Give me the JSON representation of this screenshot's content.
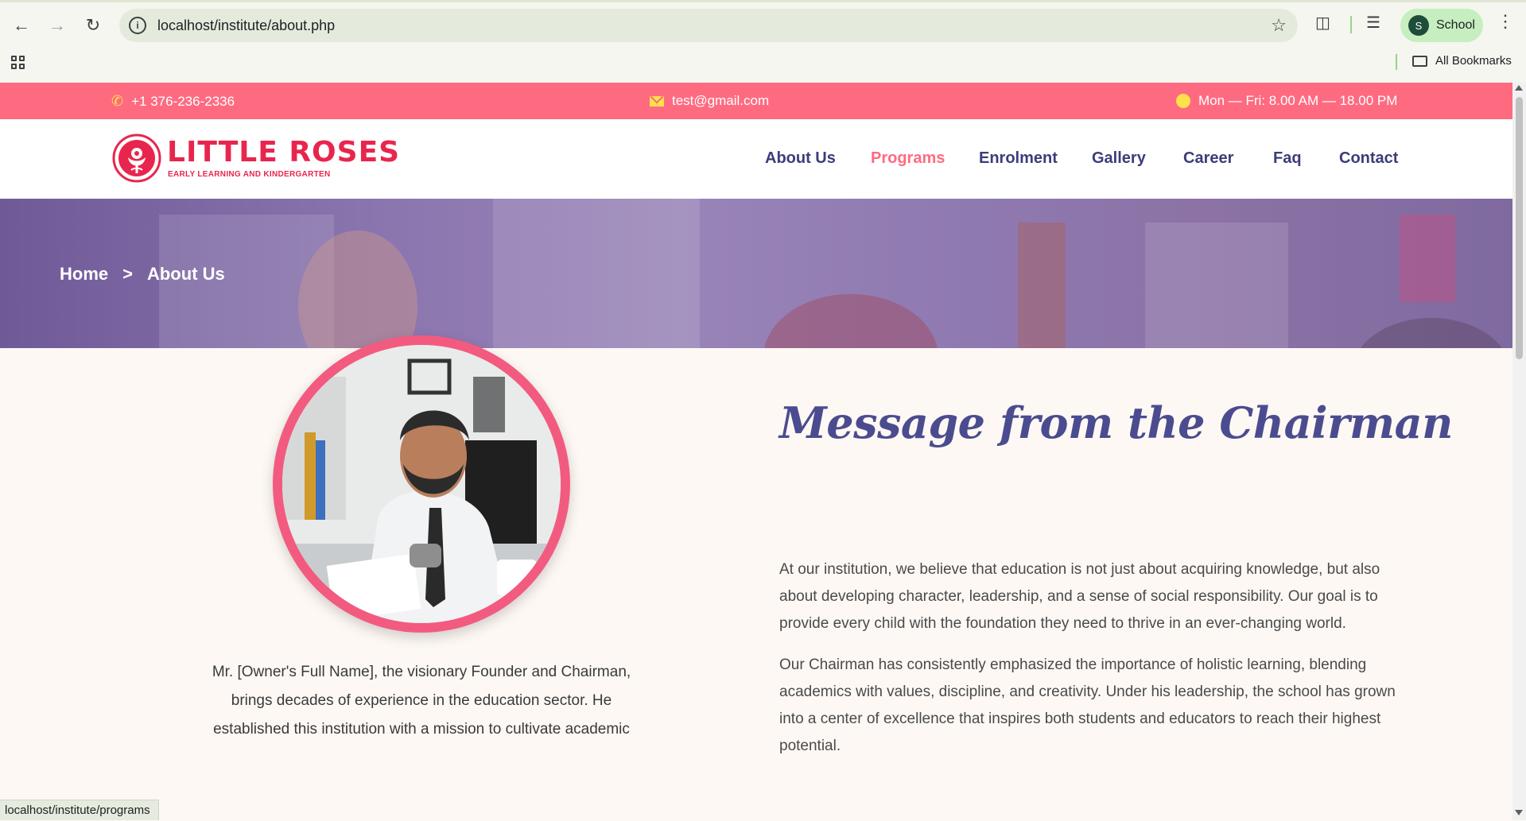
{
  "browser": {
    "url": "localhost/institute/about.php",
    "profile_initial": "S",
    "profile_name": "School",
    "bookmarks_label": "All Bookmarks",
    "status_url": "localhost/institute/programs"
  },
  "topbar": {
    "phone": "+1 376-236-2336",
    "email": "test@gmail.com",
    "hours": "Mon — Fri: 8.00 AM — 18.00 PM"
  },
  "logo": {
    "name": "LITTLE ROSES",
    "tagline": "EARLY LEARNING AND KINDERGARTEN"
  },
  "nav": {
    "items": [
      "About Us",
      "Programs",
      "Enrolment",
      "Gallery",
      "Career",
      "Faq",
      "Contact"
    ],
    "active_color": "#fe6b81",
    "color": "#3b3d79"
  },
  "breadcrumb": {
    "home": "Home",
    "separator": ">",
    "current": "About Us"
  },
  "chairman": {
    "title": "Message from the Chairman",
    "para1": "At our institution, we believe that education is not just about acquiring knowledge, but also about developing character, leadership, and a sense of social responsibility. Our goal is to provide every child with the foundation they need to thrive in an ever-changing world.",
    "para2": "Our Chairman has consistently emphasized the importance of holistic learning, blending academics with values, discipline, and creativity. Under his leadership, the school has grown into a center of excellence that inspires both students and educators to reach their highest potential.",
    "caption": "Mr. [Owner's Full Name], the visionary Founder and Chairman, brings decades of experience in the education sector. He established this institution with a mission to cultivate academic"
  },
  "colors": {
    "topbar": "#fe6b81",
    "accent_yellow": "#ffe14b",
    "brand_red": "#e8264d",
    "title_purple": "#4b4c8f"
  }
}
